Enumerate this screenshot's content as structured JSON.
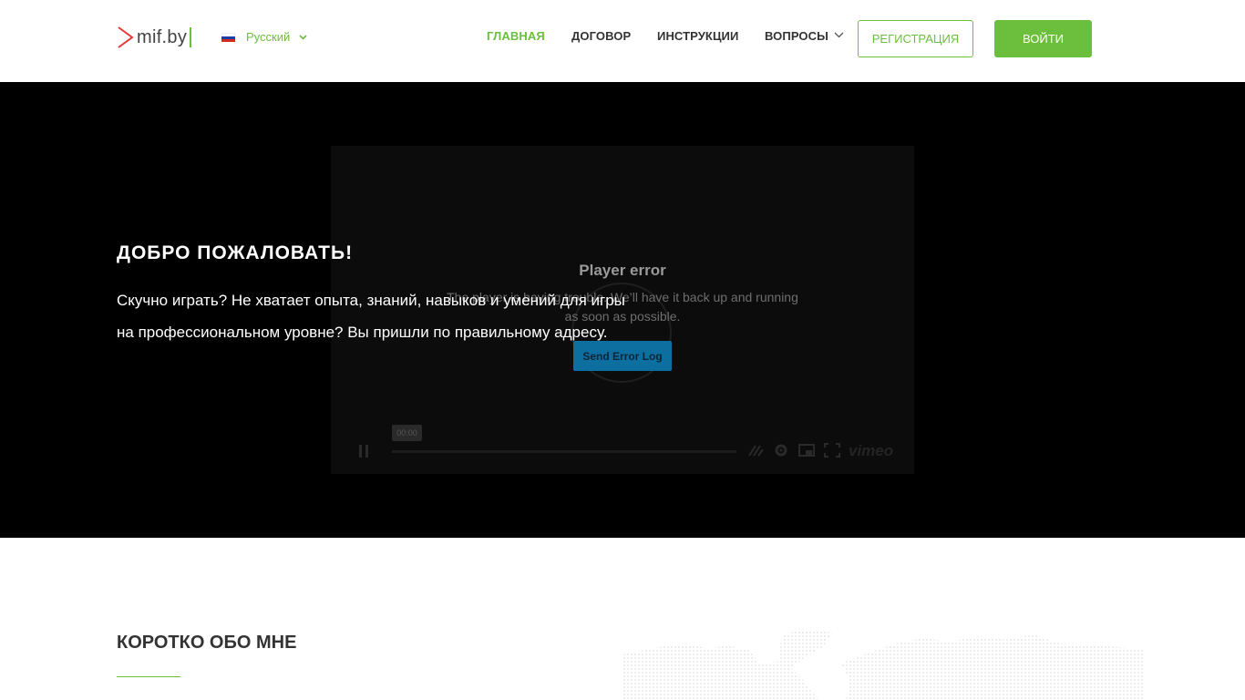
{
  "header": {
    "logo_text": "mif.by",
    "language": {
      "label": "Русский",
      "flag": "flag-ru-icon"
    },
    "nav": [
      {
        "label": "ГЛАВНАЯ",
        "active": true
      },
      {
        "label": "ДОГОВОР",
        "active": false
      },
      {
        "label": "ИНСТРУКЦИИ",
        "active": false
      },
      {
        "label": "ВОПРОСЫ",
        "active": false,
        "has_dropdown": true
      }
    ],
    "register_label": "РЕГИСТРАЦИЯ",
    "login_label": "ВОЙТИ"
  },
  "hero": {
    "title": "ДОБРО ПОЖАЛОВАТЬ!",
    "text": "Скучно играть? Не хватает опыта, знаний, навыков и умений для игры на профессиональном уровне? Вы пришли по правильному адресу.",
    "player": {
      "error_title": "Player error",
      "error_text": "The player is having trouble. We’ll have it back up and running as soon as possible.",
      "error_button": "Send Error Log",
      "time": "00:00",
      "brand": "vimeo"
    }
  },
  "about": {
    "title": "КОРОТКО ОБО МНЕ"
  },
  "colors": {
    "accent": "#6cbf3c",
    "logo_arrow": "#e53935",
    "hero_bg": "#000000",
    "player_button": "#0d6fa0"
  }
}
